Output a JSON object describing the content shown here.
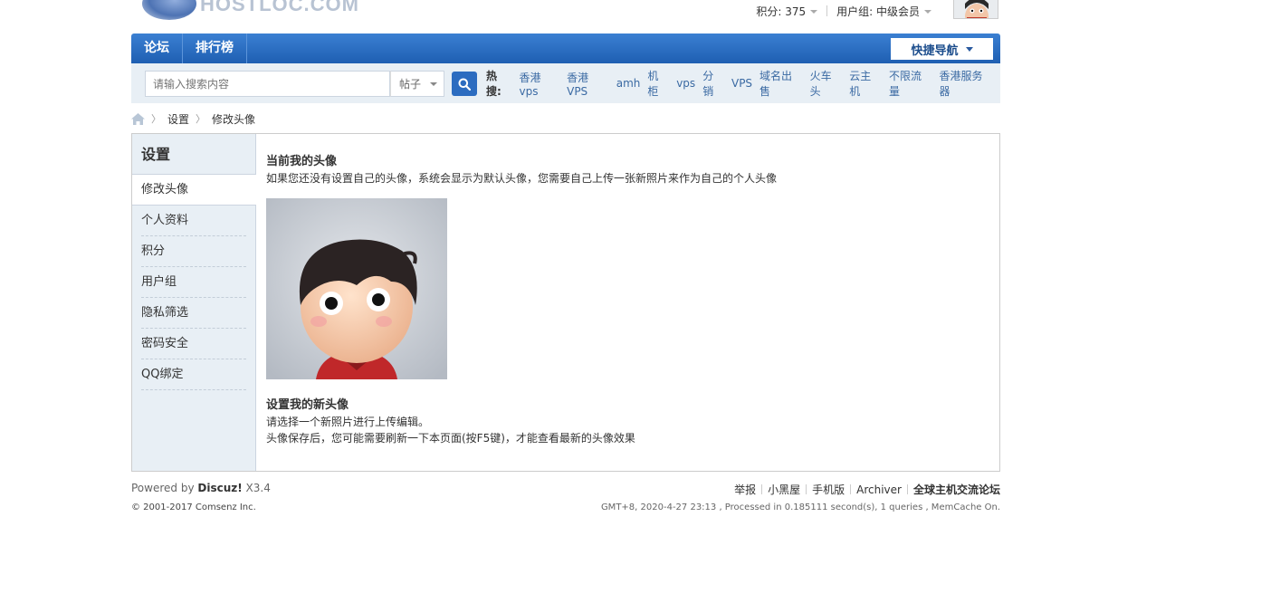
{
  "header": {
    "logo_text": "HOSTLOC.COM",
    "points_label": "积分: 375",
    "usergroup_label": "用户组: 中级会员"
  },
  "nav": {
    "items": [
      "论坛",
      "排行榜"
    ],
    "quick_nav": "快捷导航"
  },
  "search": {
    "placeholder": "请输入搜索内容",
    "type": "帖子",
    "hot_label": "热搜:",
    "hot_terms": [
      "香港vps",
      "香港VPS",
      "amh",
      "机柜",
      "vps",
      "分销",
      "VPS",
      "域名出售",
      "火车头",
      "云主机",
      "不限流量",
      "香港服务器"
    ]
  },
  "breadcrumb": {
    "home_icon": "home-icon",
    "items": [
      "设置",
      "修改头像"
    ]
  },
  "sidebar": {
    "title": "设置",
    "items": [
      "修改头像",
      "个人资料",
      "积分",
      "用户组",
      "隐私筛选",
      "密码安全",
      "QQ绑定"
    ],
    "active_index": 0
  },
  "main": {
    "current_title": "当前我的头像",
    "current_desc": "如果您还没有设置自己的头像，系统会显示为默认头像，您需要自己上传一张新照片来作为自己的个人头像",
    "new_title": "设置我的新头像",
    "new_desc1": "请选择一个新照片进行上传编辑。",
    "new_desc2": "头像保存后，您可能需要刷新一下本页面(按F5键)，才能查看最新的头像效果"
  },
  "footer": {
    "powered_prefix": "Powered by ",
    "powered_brand": "Discuz!",
    "powered_version": " X3.4",
    "copyright": "© 2001-2017 Comsenz Inc.",
    "links": [
      "举报",
      "小黑屋",
      "手机版",
      "Archiver"
    ],
    "site_name": "全球主机交流论坛",
    "meta": "GMT+8, 2020-4-27 23:13 , Processed in 0.185111 second(s), 1 queries , MemCache On."
  },
  "colors": {
    "nav_blue": "#1e5fb2",
    "link_blue": "#3b6aa3",
    "panel_bg": "#e8eff5"
  }
}
